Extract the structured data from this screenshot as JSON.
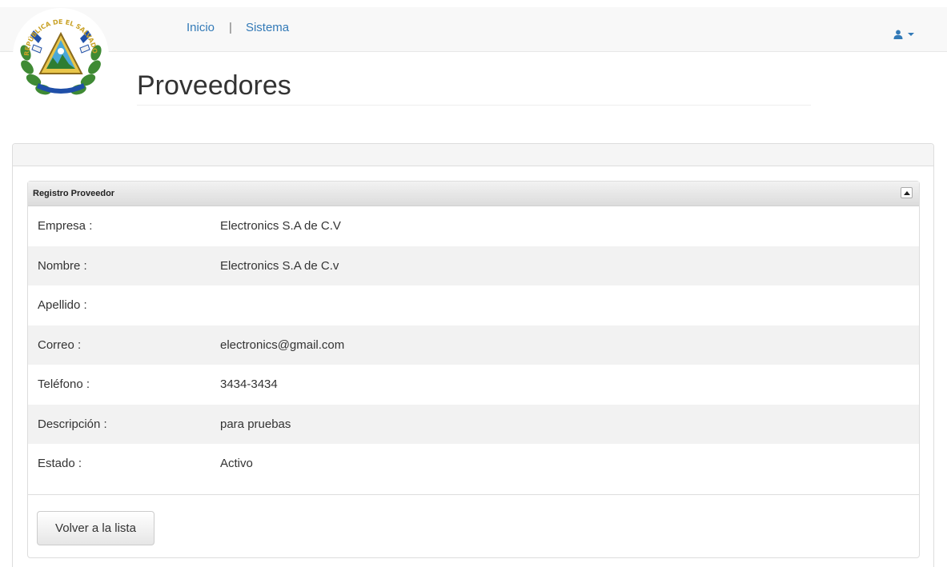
{
  "nav": {
    "links": [
      "Inicio",
      "Sistema"
    ],
    "separator": "|"
  },
  "header": {
    "title": "Proveedores",
    "logo_icon": "el-salvador-coat-of-arms",
    "logo_text": "REPÚBLICA DE EL SALVADOR EN LA AMÉRICA CENTRAL"
  },
  "user_menu": {
    "icon": "user-icon"
  },
  "panel": {
    "title": "Registro Proveedor",
    "rows": [
      {
        "label": "Empresa :",
        "value": "Electronics S.A de C.V"
      },
      {
        "label": "Nombre :",
        "value": "Electronics S.A de C.v"
      },
      {
        "label": "Apellido :",
        "value": ""
      },
      {
        "label": "Correo :",
        "value": "electronics@gmail.com"
      },
      {
        "label": "Teléfono :",
        "value": "3434-3434"
      },
      {
        "label": "Descripción :",
        "value": "para pruebas"
      },
      {
        "label": "Estado :",
        "value": "Activo"
      }
    ],
    "back_button": "Volver a la lista"
  },
  "colors": {
    "link": "#337ab7",
    "stripe": "#f2f2f2",
    "navbar": "#f8f8f8"
  }
}
